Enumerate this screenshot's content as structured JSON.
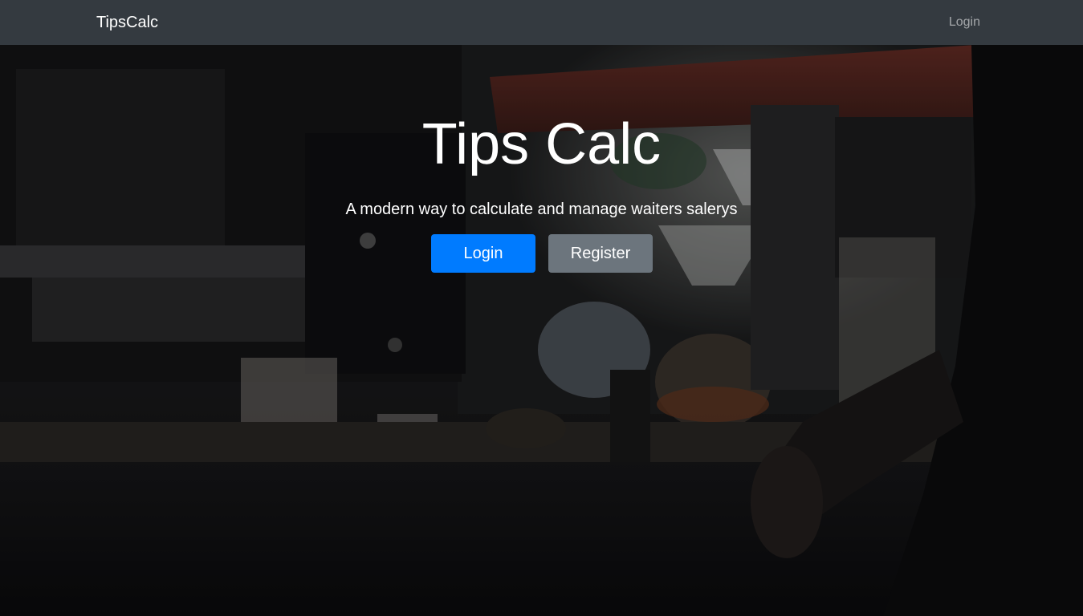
{
  "navbar": {
    "brand": "TipsCalc",
    "login_link": "Login"
  },
  "hero": {
    "title": "Tips Calc",
    "subtitle": "A modern way to calculate and manage waiters salerys",
    "login_button": "Login",
    "register_button": "Register",
    "background": "coffee-bar-photo"
  },
  "colors": {
    "navbar_bg": "#343a40",
    "primary": "#007bff",
    "secondary": "#6c757d"
  }
}
